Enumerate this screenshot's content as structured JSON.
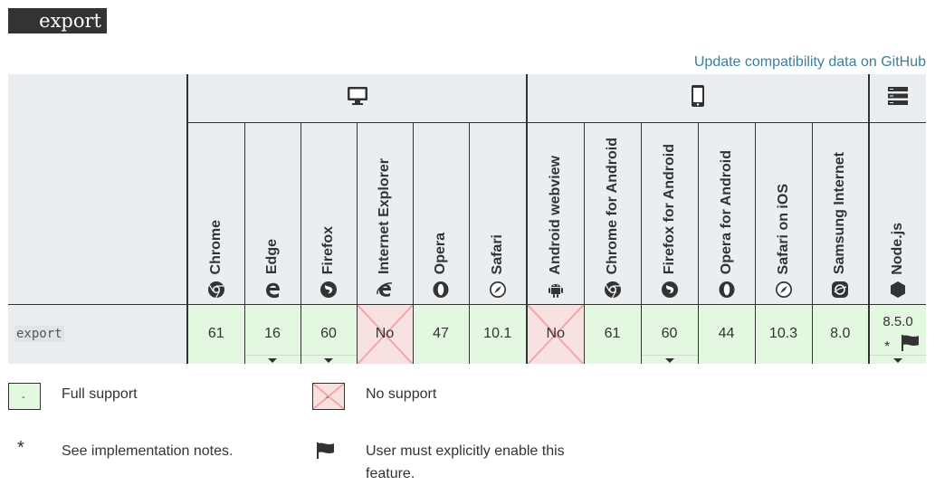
{
  "title": "export",
  "github_link": "Update compatibility data on GitHub",
  "groups": {
    "desktop_icon": "monitor-icon",
    "mobile_icon": "phone-icon",
    "server_icon": "server-icon"
  },
  "browsers": [
    {
      "name": "Chrome",
      "icon": "chrome-icon",
      "value": "61",
      "support": "full"
    },
    {
      "name": "Edge",
      "icon": "edge-icon",
      "value": "16",
      "support": "full",
      "notes": true
    },
    {
      "name": "Firefox",
      "icon": "firefox-icon",
      "value": "60",
      "support": "full",
      "notes": true
    },
    {
      "name": "Internet Explorer",
      "icon": "ie-icon",
      "value": "No",
      "support": "none"
    },
    {
      "name": "Opera",
      "icon": "opera-icon",
      "value": "47",
      "support": "full"
    },
    {
      "name": "Safari",
      "icon": "safari-icon",
      "value": "10.1",
      "support": "full"
    },
    {
      "name": "Android webview",
      "icon": "android-icon",
      "value": "No",
      "support": "none"
    },
    {
      "name": "Chrome for Android",
      "icon": "chrome-icon",
      "value": "61",
      "support": "full"
    },
    {
      "name": "Firefox for Android",
      "icon": "firefox-icon",
      "value": "60",
      "support": "full",
      "notes": true
    },
    {
      "name": "Opera for Android",
      "icon": "opera-icon",
      "value": "44",
      "support": "full"
    },
    {
      "name": "Safari on iOS",
      "icon": "safari-icon",
      "value": "10.3",
      "support": "full"
    },
    {
      "name": "Samsung Internet",
      "icon": "samsung-icon",
      "value": "8.0",
      "support": "full"
    },
    {
      "name": "Node.js",
      "icon": "nodejs-icon",
      "value": "8.5.0",
      "support": "full",
      "notes": true,
      "flag": true
    }
  ],
  "feature": "export",
  "legend": {
    "full_support": "Full support",
    "no_support": "No support",
    "notes_symbol": "*",
    "notes": "See implementation notes.",
    "flag_line1": "User must explicitly enable this",
    "flag_line2": "feature.",
    "box_mark": "-"
  },
  "colors": {
    "yes_bg": "#e4f8e1",
    "no_bg": "#f8e1e1",
    "link": "#3d7e9a",
    "header_bg": "#eaeef0"
  }
}
